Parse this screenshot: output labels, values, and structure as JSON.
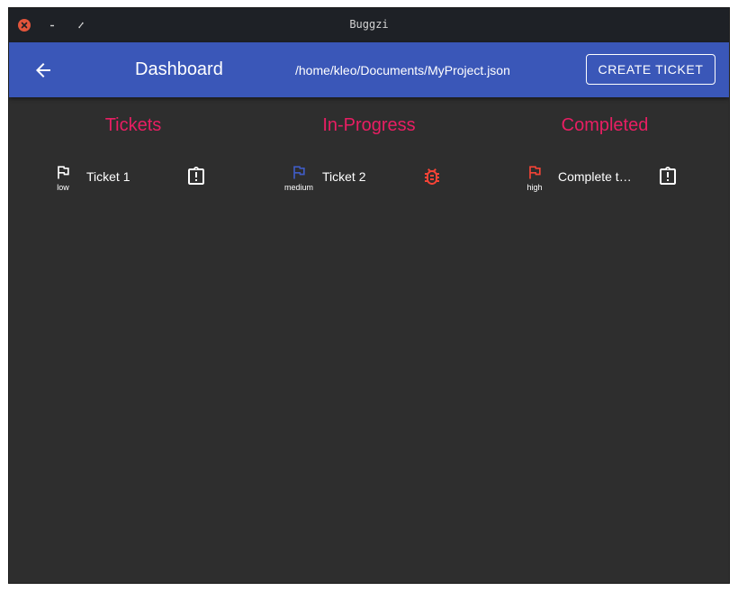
{
  "window": {
    "title": "Buggzi"
  },
  "appbar": {
    "title": "Dashboard",
    "path": "/home/kleo/Documents/MyProject.json",
    "create_label": "CREATE TICKET",
    "back_icon": "arrow-left-icon"
  },
  "columns": [
    {
      "title": "Tickets",
      "tickets": [
        {
          "name": "Ticket 1",
          "priority": "low",
          "flag_color": "#ffffff",
          "type_icon": "clipboard-alert-icon"
        }
      ]
    },
    {
      "title": "In-Progress",
      "tickets": [
        {
          "name": "Ticket 2",
          "priority": "medium",
          "flag_color": "#3f5bc4",
          "type_icon": "bug-icon"
        }
      ]
    },
    {
      "title": "Completed",
      "tickets": [
        {
          "name": "Complete t…",
          "priority": "high",
          "flag_color": "#f44336",
          "type_icon": "clipboard-alert-icon"
        }
      ]
    }
  ],
  "colors": {
    "appbar": "#3a57b8",
    "column_title": "#e91e63",
    "background": "#2e2e2e",
    "bug": "#f44336"
  }
}
